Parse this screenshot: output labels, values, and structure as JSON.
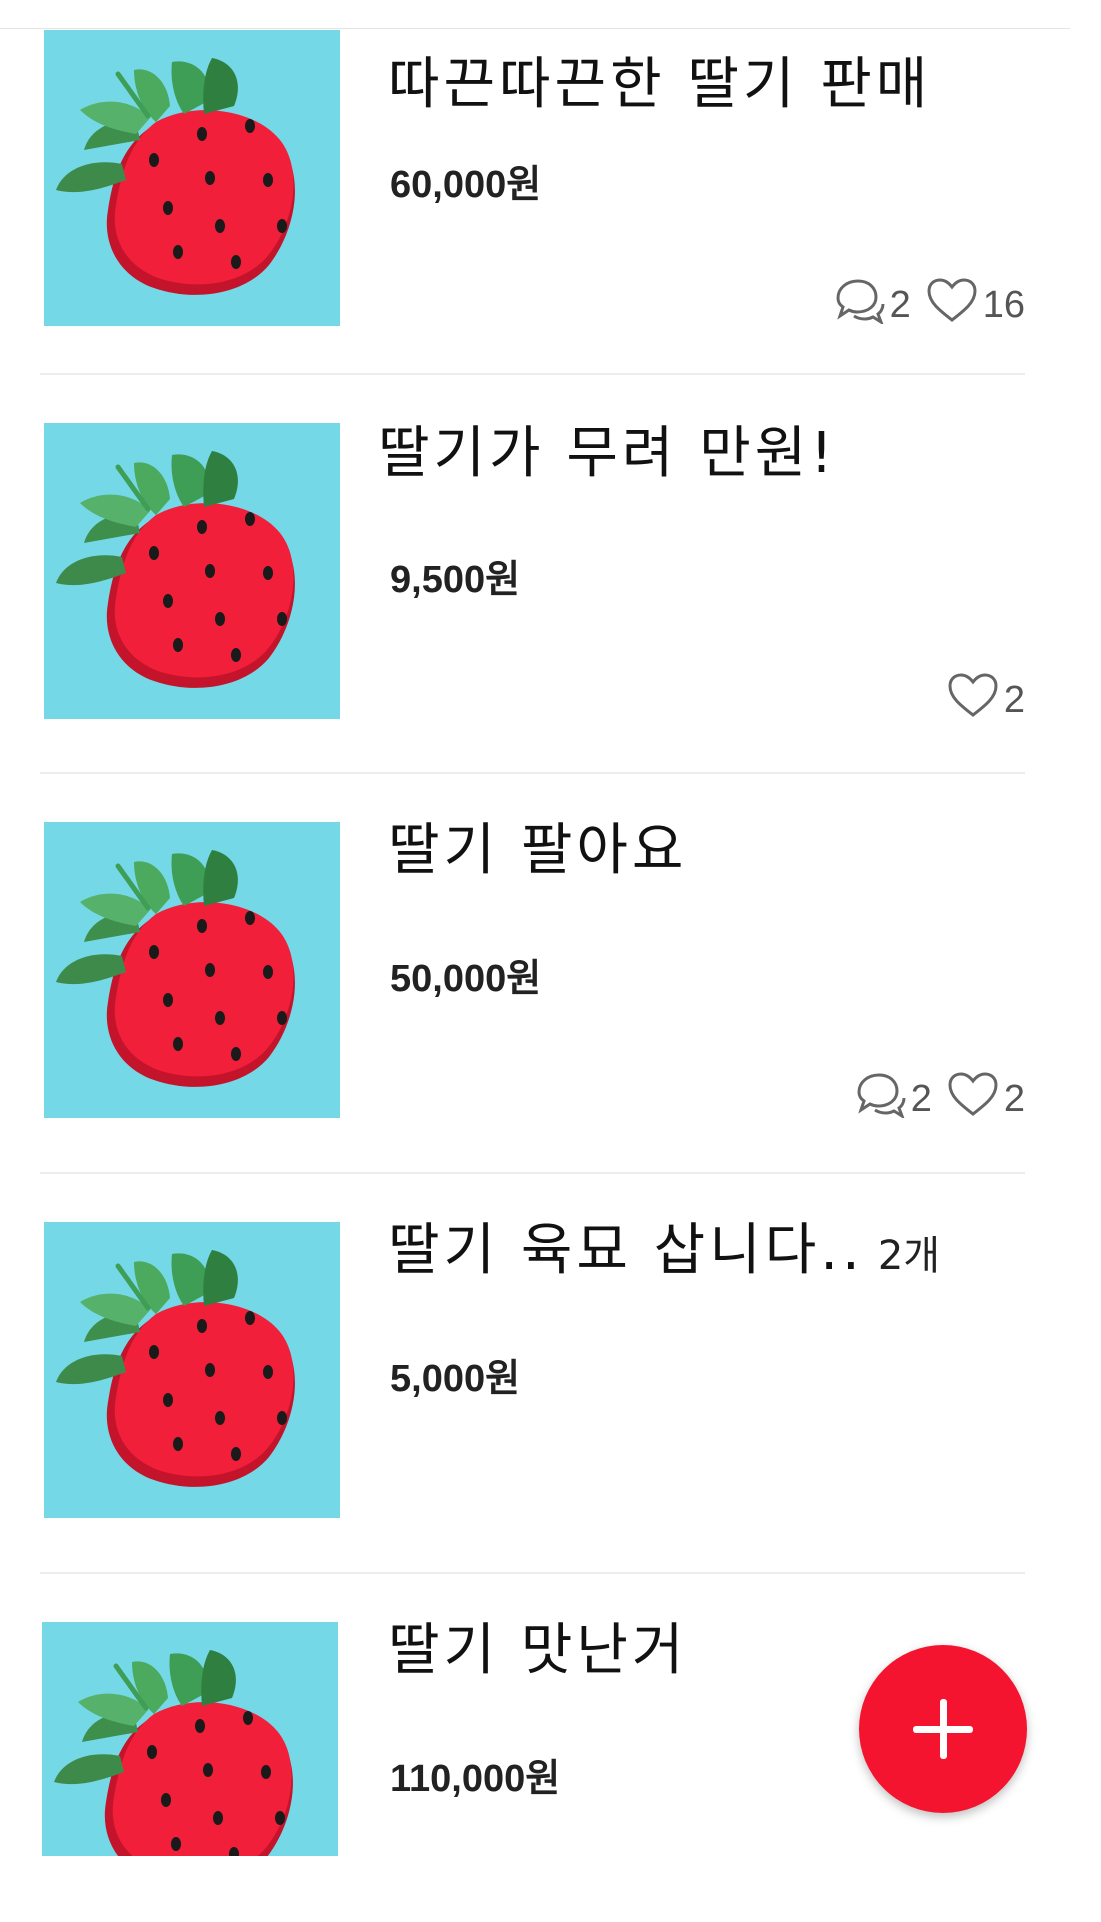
{
  "listings": [
    {
      "title": "따끈따끈한 딸기 판매",
      "quantity": "",
      "price": "60,000원",
      "comments": "2",
      "likes": "16",
      "thumbnail_icon": "strawberry-icon"
    },
    {
      "title": "딸기가 무려 만원!",
      "quantity": "",
      "price": "9,500원",
      "comments": "",
      "likes": "2",
      "thumbnail_icon": "strawberry-icon"
    },
    {
      "title": "딸기 팔아요",
      "quantity": "",
      "price": "50,000원",
      "comments": "2",
      "likes": "2",
      "thumbnail_icon": "strawberry-icon"
    },
    {
      "title": "딸기 육묘 삽니다..",
      "quantity": "2개",
      "price": "5,000원",
      "comments": "",
      "likes": "",
      "thumbnail_icon": "strawberry-icon"
    },
    {
      "title": "딸기 맛난거",
      "quantity": "",
      "price": "110,000원",
      "comments": "",
      "likes": "",
      "thumbnail_icon": "strawberry-icon"
    }
  ],
  "fab": {
    "icon": "plus-icon",
    "color": "#f5142f"
  },
  "colors": {
    "thumbnail_bg": "#74d8e6",
    "strawberry": "#f21f3a",
    "leaf": "#3f9e55"
  }
}
